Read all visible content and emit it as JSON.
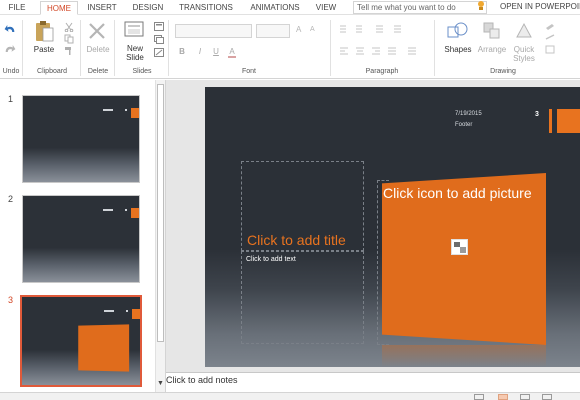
{
  "tabs": [
    {
      "label": "FILE",
      "active": false
    },
    {
      "label": "HOME",
      "active": true
    },
    {
      "label": "INSERT",
      "active": false
    },
    {
      "label": "DESIGN",
      "active": false
    },
    {
      "label": "TRANSITIONS",
      "active": false
    },
    {
      "label": "ANIMATIONS",
      "active": false
    },
    {
      "label": "VIEW",
      "active": false
    }
  ],
  "tell_me_placeholder": "Tell me what you want to do",
  "open_in": "OPEN IN POWERPOINT",
  "ribbon": {
    "undo_group": "Undo",
    "clipboard": {
      "paste": "Paste",
      "group": "Clipboard"
    },
    "delete": {
      "label": "Delete",
      "group": "Delete"
    },
    "slides": {
      "new_slide_line1": "New",
      "new_slide_line2": "Slide",
      "group": "Slides"
    },
    "font": {
      "group": "Font",
      "bold": "B",
      "italic": "I",
      "underline": "U",
      "font_color": "A"
    },
    "paragraph": {
      "group": "Paragraph"
    },
    "drawing": {
      "shapes": "Shapes",
      "arrange": "Arrange",
      "quick_styles_line1": "Quick",
      "quick_styles_line2": "Styles",
      "group": "Drawing"
    }
  },
  "thumbnails": [
    {
      "number": "1",
      "selected": false,
      "has_picture": false
    },
    {
      "number": "2",
      "selected": false,
      "has_picture": false
    },
    {
      "number": "3",
      "selected": true,
      "has_picture": true
    }
  ],
  "slide": {
    "date": "7/19/2015",
    "footer": "Footer",
    "number": "3",
    "title_placeholder": "Click to add title",
    "text_placeholder": "Click to add text",
    "picture_placeholder": "Click icon to add picture"
  },
  "notes_placeholder": "Click to add notes",
  "colors": {
    "accent": "#d24726",
    "slide_orange": "#e06c1c",
    "slide_bg": "#2b3037"
  }
}
